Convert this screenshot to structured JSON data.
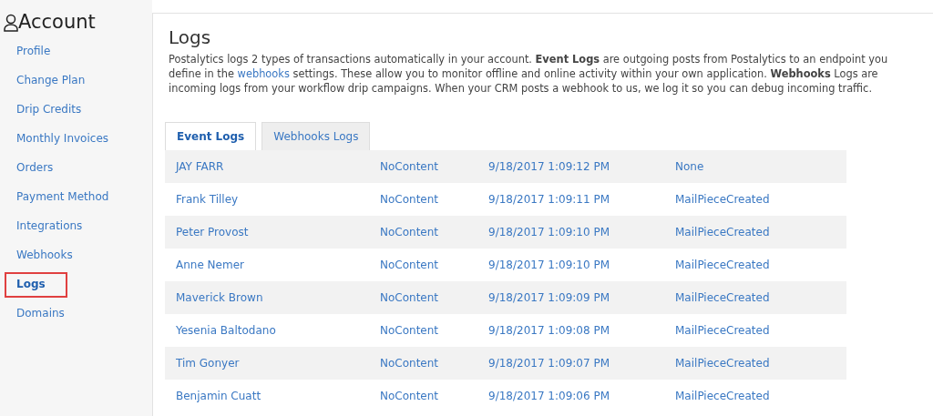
{
  "sidebar": {
    "title": "Account",
    "items": [
      {
        "label": "Profile",
        "selected": false
      },
      {
        "label": "Change Plan",
        "selected": false
      },
      {
        "label": "Drip Credits",
        "selected": false
      },
      {
        "label": "Monthly Invoices",
        "selected": false
      },
      {
        "label": "Orders",
        "selected": false
      },
      {
        "label": "Payment Method",
        "selected": false
      },
      {
        "label": "Integrations",
        "selected": false
      },
      {
        "label": "Webhooks",
        "selected": false
      },
      {
        "label": "Logs",
        "selected": true
      },
      {
        "label": "Domains",
        "selected": false
      }
    ]
  },
  "main": {
    "title": "Logs",
    "description_parts": [
      {
        "kind": "text",
        "text": "Postalytics logs 2 types of transactions automatically in your account. **Event Logs** are outgoing posts from Postalytics to an endpoint you define in the "
      },
      {
        "kind": "link",
        "text": "webhooks"
      },
      {
        "kind": "text",
        "text": " settings. These allow you to monitor offline and online activity within your own application. **Webhooks** Logs are incoming logs from your workflow drip campaigns. When your CRM posts a webhook to us, we log it so you can debug incoming traffic."
      }
    ],
    "tabs": [
      {
        "label": "Event Logs",
        "selected": true
      },
      {
        "label": "Webhooks Logs",
        "selected": false
      }
    ],
    "table": {
      "rows": [
        [
          "JAY FARR",
          "NoContent",
          "9/18/2017 1:09:12 PM",
          "None"
        ],
        [
          "Frank Tilley",
          "NoContent",
          "9/18/2017 1:09:11 PM",
          "MailPieceCreated"
        ],
        [
          "Peter Provost",
          "NoContent",
          "9/18/2017 1:09:10 PM",
          "MailPieceCreated"
        ],
        [
          "Anne Nemer",
          "NoContent",
          "9/18/2017 1:09:10 PM",
          "MailPieceCreated"
        ],
        [
          "Maverick Brown",
          "NoContent",
          "9/18/2017 1:09:09 PM",
          "MailPieceCreated"
        ],
        [
          "Yesenia Baltodano",
          "NoContent",
          "9/18/2017 1:09:08 PM",
          "MailPieceCreated"
        ],
        [
          "Tim Gonyer",
          "NoContent",
          "9/18/2017 1:09:07 PM",
          "MailPieceCreated"
        ],
        [
          "Benjamin Cuatt",
          "NoContent",
          "9/18/2017 1:09:06 PM",
          "MailPieceCreated"
        ]
      ]
    }
  }
}
